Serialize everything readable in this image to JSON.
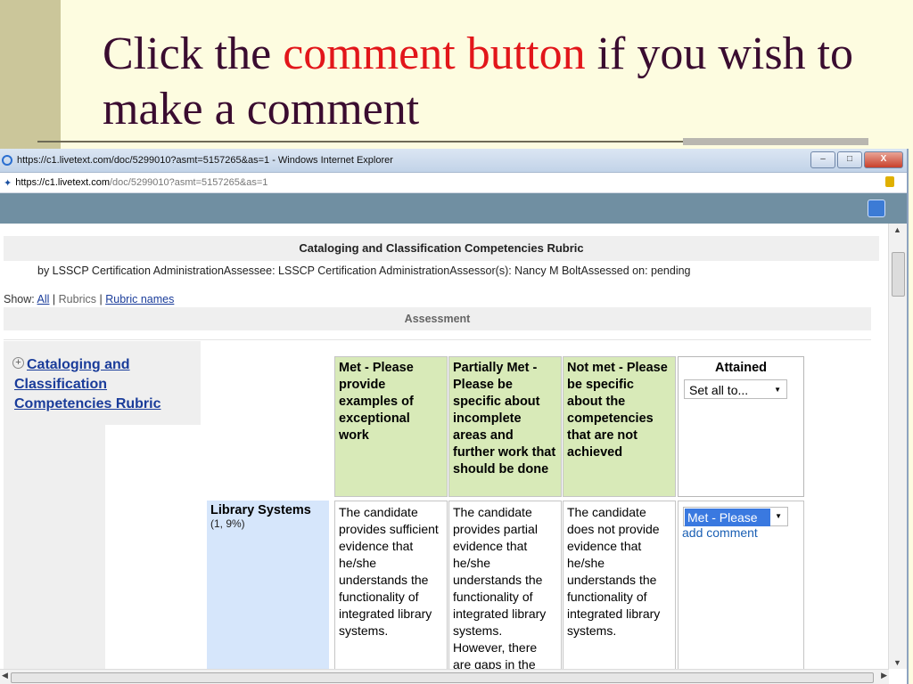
{
  "slide": {
    "title_part1": "Click the ",
    "title_highlight": "comment button",
    "title_part2": " if you wish to make a comment",
    "accent_color": "#e2161a"
  },
  "browser": {
    "window_title": "https://c1.livetext.com/doc/5299010?asmt=5157265&as=1 - Windows Internet Explorer",
    "address_host": "https://c1.livetext.com",
    "address_path": "/doc/5299010?asmt=5157265&as=1",
    "minimize": "–",
    "maximize": "□",
    "close": "X"
  },
  "page": {
    "rubric_title": "Cataloging and Classification Competencies Rubric",
    "byline": "by LSSCP Certification AdministrationAssessee: LSSCP Certification AdministrationAssessor(s): Nancy M BoltAssessed on: pending",
    "show_label": "Show:",
    "show_all": "All",
    "show_rubrics": "Rubrics",
    "show_rubric_names": "Rubric names",
    "assessment_label": "Assessment",
    "rubric_link": "Cataloging and Classification Competencies Rubric",
    "headers": [
      "Met - Please provide examples of exceptional work",
      "Partially Met - Please be specific about incomplete areas and further work that should be done",
      "Not met - Please be specific about the competencies that are not achieved"
    ],
    "attained_label": "Attained",
    "set_all": "Set all to...",
    "row": {
      "name": "Library Systems",
      "meta": "(1, 9%)",
      "cells": [
        "The candidate provides sufficient evidence that he/she understands the functionality of integrated library systems.",
        "The candidate provides partial evidence that he/she understands the functionality of integrated library systems. However, there are gaps in the",
        "The candidate does not provide evidence that he/she understands the functionality of integrated library systems."
      ],
      "attained_value": "Met - Please",
      "add_comment": "add comment"
    }
  }
}
